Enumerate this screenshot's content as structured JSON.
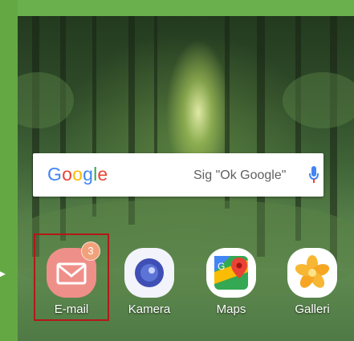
{
  "search": {
    "logo_letters": [
      "G",
      "o",
      "o",
      "g",
      "l",
      "e"
    ],
    "hint": "Sig \"Ok Google\"",
    "icon": "microphone-icon"
  },
  "apps": [
    {
      "label": "E-mail",
      "icon": "mail-envelope-icon",
      "badge": "3",
      "selected": true
    },
    {
      "label": "Kamera",
      "icon": "camera-lens-icon",
      "badge": null,
      "selected": false
    },
    {
      "label": "Maps",
      "icon": "google-maps-icon",
      "badge": null,
      "selected": false
    },
    {
      "label": "Galleri",
      "icon": "gallery-flower-icon",
      "badge": null,
      "selected": false
    }
  ],
  "colors": {
    "frame": "#6ab04c",
    "selection": "#b31818",
    "email_icon": "#ef8f8a"
  }
}
